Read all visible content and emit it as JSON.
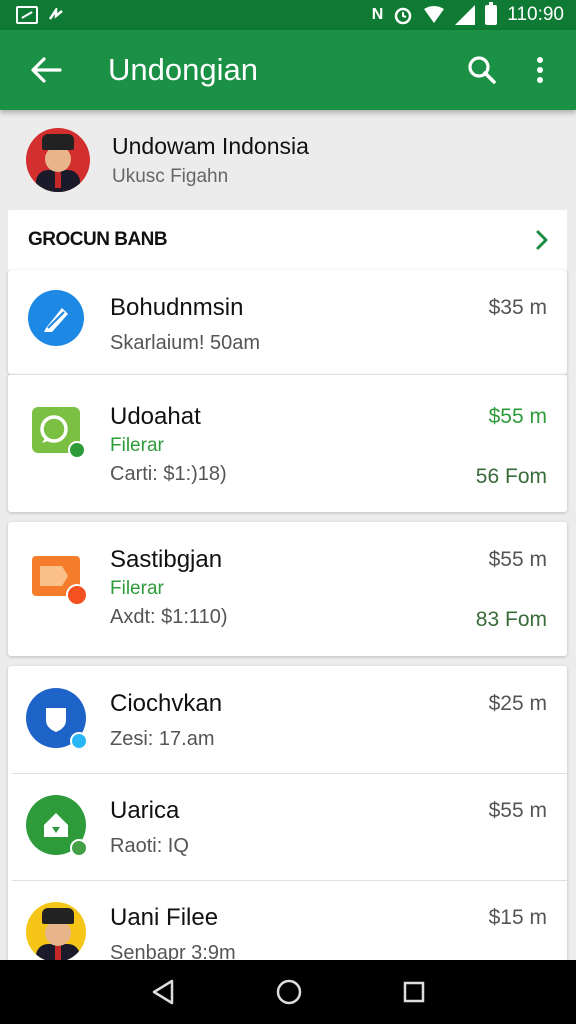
{
  "status_bar": {
    "time": "110:90",
    "nfc_glyph": "N",
    "left_icons": [
      "gallery-icon",
      "notification-icon"
    ],
    "right_icons": [
      "nfc-icon",
      "alarm-icon",
      "wifi-icon",
      "signal-icon",
      "battery-icon"
    ]
  },
  "app_bar": {
    "title": "Undongian",
    "back_icon": "arrow-back-icon",
    "search_icon": "search-icon",
    "menu_icon": "more-vert-icon",
    "color": "#1b9146"
  },
  "profile": {
    "name": "Undowam Indonsia",
    "subtitle": "Ukusc Figahn"
  },
  "section": {
    "title": "GROCUN BANB",
    "chevron_icon": "chevron-right-icon"
  },
  "items": [
    {
      "name": "Bohudnmsin",
      "meta": "Skarlaium! 50am",
      "amount": "$35 m",
      "icon": "blue-pencil-icon"
    },
    {
      "name": "Udoahat",
      "tag": "Filerar",
      "meta": "Carti: $1:)18)",
      "amount": "$55 m",
      "time": "56 Fom",
      "icon": "green-chat-icon"
    },
    {
      "name": "Sastibgjan",
      "tag": "Filerar",
      "meta": "Axdt: $1:110)",
      "amount": "$55 m",
      "time": "83 Fom",
      "icon": "orange-folder-icon"
    },
    {
      "name": "Ciochvkan",
      "meta": "Zesi: 17.am",
      "amount": "$25 m",
      "icon": "blue-shield-icon"
    },
    {
      "name": "Uarica",
      "meta": "Raoti: IQ",
      "amount": "$55 m",
      "icon": "green-home-icon"
    },
    {
      "name": "Uani Filee",
      "meta": "Senbapr 3:9m",
      "amount": "$15 m",
      "icon": "avatar"
    }
  ],
  "nav_bar": {
    "back": "nav-back-icon",
    "home": "nav-home-icon",
    "recents": "nav-recents-icon"
  },
  "colors": {
    "accent_green": "#2e9b3a",
    "status_green": "#0e7a33"
  }
}
